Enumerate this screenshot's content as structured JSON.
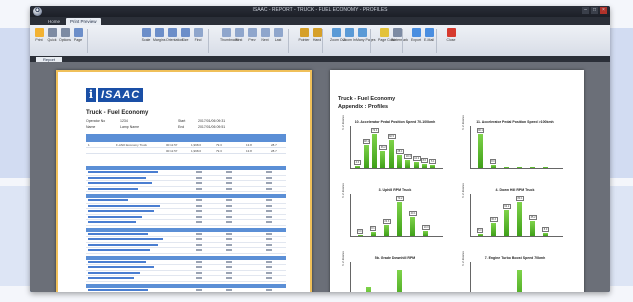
{
  "window": {
    "title": "ISAAC - REPORT - TRUCK - FUEL ECONOMY - PROFILES",
    "orb_label": "O"
  },
  "ribbon_tabs": [
    {
      "label": "Home"
    },
    {
      "label": "Print Preview"
    }
  ],
  "ribbon_buttons": [
    {
      "label": "Print",
      "color": "#f2b233"
    },
    {
      "label": "Quick",
      "color": "#7d8ba3"
    },
    {
      "label": "Options",
      "color": "#7d8ba3"
    },
    {
      "label": "Page",
      "color": "#6c8ec9"
    },
    {
      "label": "Scale",
      "color": "#6c8ec9"
    },
    {
      "label": "Margins",
      "color": "#6c8ec9"
    },
    {
      "label": "Orientation",
      "color": "#6c8ec9"
    },
    {
      "label": "Size",
      "color": "#6c8ec9"
    },
    {
      "label": "Find",
      "color": "#8fa6cc"
    },
    {
      "label": "Thumbnails",
      "color": "#8fa6cc"
    },
    {
      "label": "First",
      "color": "#8fa6cc"
    },
    {
      "label": "Prev",
      "color": "#8fa6cc"
    },
    {
      "label": "Next",
      "color": "#8fa6cc"
    },
    {
      "label": "Last",
      "color": "#8fa6cc"
    },
    {
      "label": "Pointer",
      "color": "#d6a02a"
    },
    {
      "label": "Hand",
      "color": "#d6a02a"
    },
    {
      "label": "Zoom Out",
      "color": "#5a9ad6"
    },
    {
      "label": "Zoom In",
      "color": "#5a9ad6"
    },
    {
      "label": "Many Pages",
      "color": "#5a9ad6"
    },
    {
      "label": "Page Color",
      "color": "#e3c23a"
    },
    {
      "label": "Watermark",
      "color": "#7d8ba3"
    },
    {
      "label": "Export",
      "color": "#4a8ee0"
    },
    {
      "label": "E-Mail",
      "color": "#4a8ee0"
    },
    {
      "label": "Close",
      "color": "#d63a2e"
    }
  ],
  "status_tab": {
    "label": "Report"
  },
  "left_page": {
    "logo_text": "ISAAC",
    "title": "Truck - Fuel Economy",
    "meta": [
      {
        "label": "Operator No",
        "value": "1234",
        "label2": "Start",
        "value2": "2017/01/06 09:31"
      },
      {
        "label": "Name",
        "value": "Lamp Name",
        "label2": "End",
        "value2": "2017/01/06 09:51"
      }
    ],
    "summary_rows": [
      {
        "c1": "1",
        "c2": "F-ANO Economy Truck",
        "c3": "00:11:57",
        "c4": "1,998.0",
        "c5": "79.3",
        "c6": "13.8",
        "c7": "28.7"
      },
      {
        "c1": "",
        "c2": "",
        "c3": "00:11:57",
        "c4": "1,998.0",
        "c5": "79.3",
        "c6": "13.8",
        "c7": "28.7"
      }
    ]
  },
  "right_page": {
    "title": "Truck - Fuel Economy",
    "subtitle": "Appendix : Profiles"
  },
  "chart_data": [
    {
      "type": "bar",
      "title": "10. Accelerator Pedal Position Speed 70-100kmh",
      "ylabel": "% of distance",
      "values": [
        4,
        48,
        72,
        36,
        60,
        28,
        18,
        12,
        8,
        6
      ],
      "labels": [
        "4.0",
        "48.1",
        "72.4",
        "36.2",
        "60.5",
        "28.1",
        "18.3",
        "12.2",
        "8.0",
        "6.1"
      ]
    },
    {
      "type": "bar",
      "title": "11. Accelerator Pedal Position Speed >100kmh",
      "ylabel": "% of distance",
      "values": [
        90,
        8,
        4,
        2,
        1,
        1
      ],
      "labels": [
        "90.1",
        "8.0",
        "",
        "",
        "",
        ""
      ]
    },
    {
      "type": "bar",
      "title": "3. Uphill RPM Truck",
      "ylabel": "% of distance",
      "values": [
        3,
        8,
        22,
        70,
        40,
        10
      ],
      "labels": [
        "3.0",
        "8.1",
        "22.3",
        "70.2",
        "40.1",
        "10.0"
      ]
    },
    {
      "type": "bar",
      "title": "4. Down Hill RPM Truck",
      "ylabel": "% of distance",
      "values": [
        5,
        30,
        62,
        80,
        35,
        8
      ],
      "labels": [
        "5.0",
        "30.4",
        "62.2",
        "80.1",
        "35.2",
        "8.0"
      ]
    },
    {
      "type": "bar",
      "title": "5b. Grade Downhill RPM",
      "ylabel": "% of distance",
      "values": [
        10,
        20
      ],
      "labels": [
        "",
        ""
      ]
    },
    {
      "type": "bar",
      "title": "7. Engine Turbo Boost Speed 70kmh",
      "ylabel": "% of distance",
      "values": [
        20,
        60
      ],
      "labels": [
        "",
        ""
      ]
    }
  ]
}
